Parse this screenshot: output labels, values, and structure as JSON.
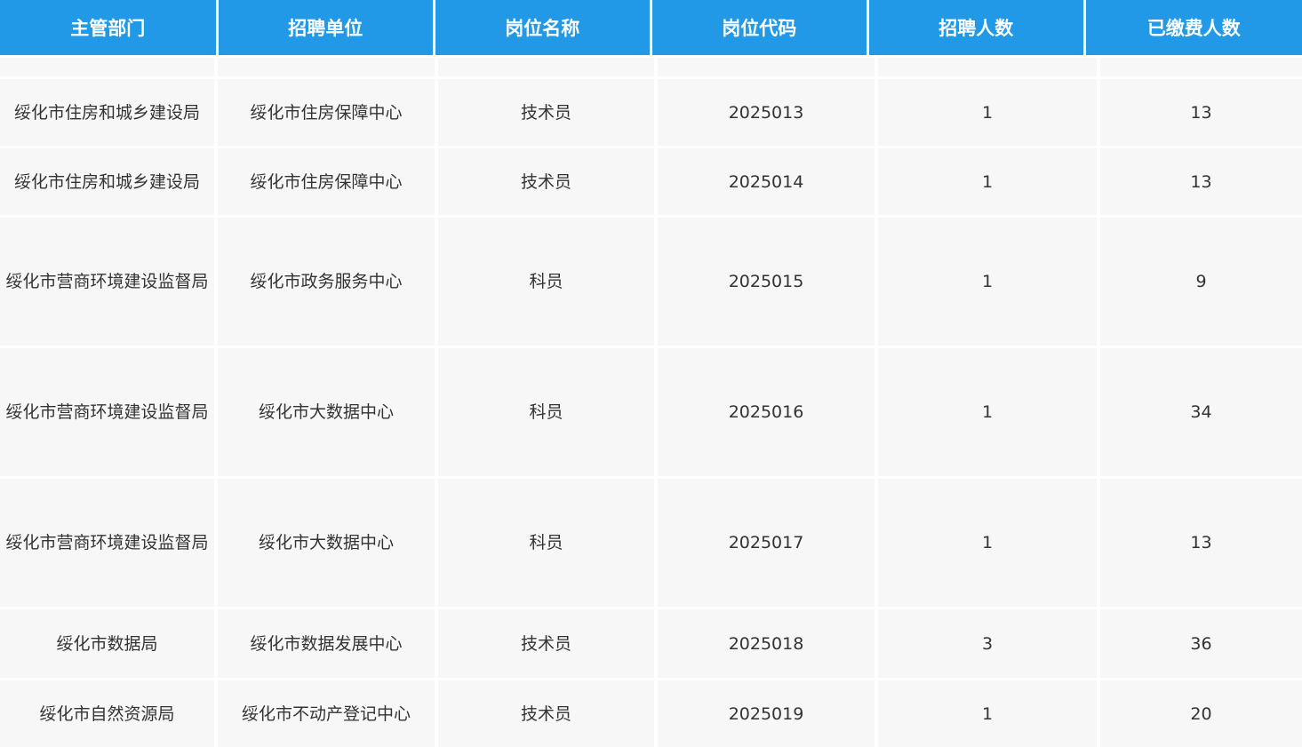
{
  "table": {
    "headers": [
      "主管部门",
      "招聘单位",
      "岗位名称",
      "岗位代码",
      "招聘人数",
      "已缴费人数"
    ],
    "rows": [
      {
        "dept": "",
        "unit": "",
        "position": "",
        "code": "",
        "quota": "",
        "paid": ""
      },
      {
        "dept": "绥化市住房和城乡建设局",
        "unit": "绥化市住房保障中心",
        "position": "技术员",
        "code": "2025013",
        "quota": "1",
        "paid": "13"
      },
      {
        "dept": "绥化市住房和城乡建设局",
        "unit": "绥化市住房保障中心",
        "position": "技术员",
        "code": "2025014",
        "quota": "1",
        "paid": "13"
      },
      {
        "dept": "绥化市营商环境建设监督局",
        "unit": "绥化市政务服务中心",
        "position": "科员",
        "code": "2025015",
        "quota": "1",
        "paid": "9"
      },
      {
        "dept": "绥化市营商环境建设监督局",
        "unit": "绥化市大数据中心",
        "position": "科员",
        "code": "2025016",
        "quota": "1",
        "paid": "34"
      },
      {
        "dept": "绥化市营商环境建设监督局",
        "unit": "绥化市大数据中心",
        "position": "科员",
        "code": "2025017",
        "quota": "1",
        "paid": "13"
      },
      {
        "dept": "绥化市数据局",
        "unit": "绥化市数据发展中心",
        "position": "技术员",
        "code": "2025018",
        "quota": "3",
        "paid": "36"
      },
      {
        "dept": "绥化市自然资源局",
        "unit": "绥化市不动产登记中心",
        "position": "技术员",
        "code": "2025019",
        "quota": "1",
        "paid": "20"
      }
    ]
  }
}
